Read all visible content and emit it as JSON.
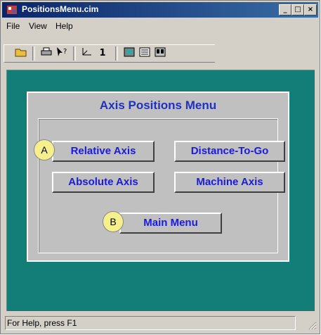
{
  "window": {
    "title": "PositionsMenu.cim",
    "minimize_glyph": "_",
    "maximize_glyph": "□",
    "close_glyph": "×"
  },
  "menu": {
    "file": "File",
    "view": "View",
    "help": "Help"
  },
  "toolbar": {
    "open_icon": "folder-open-icon",
    "print_icon": "printer-icon",
    "help_icon": "context-help-icon",
    "axis_icon": "axis-icon",
    "number_label": "1",
    "view1_icon": "screen-icon",
    "view2_icon": "list-icon",
    "view3_icon": "display-icon"
  },
  "panel": {
    "title": "Axis Positions Menu",
    "buttons": {
      "relative_axis": "Relative Axis",
      "distance_to_go": "Distance-To-Go",
      "absolute_axis": "Absolute Axis",
      "machine_axis": "Machine Axis",
      "main_menu": "Main Menu"
    },
    "markers": {
      "a": "A",
      "b": "B"
    }
  },
  "status": {
    "text": "For Help, press F1"
  },
  "colors": {
    "background_teal": "#137d78",
    "button_text": "#1a1ae0",
    "title_text": "#2030c0",
    "marker_fill": "#f5ef8c"
  }
}
